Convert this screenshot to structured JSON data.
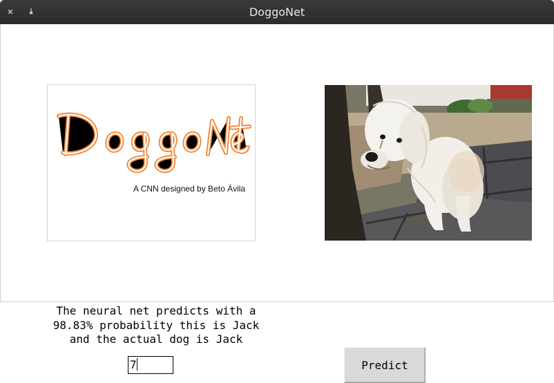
{
  "window": {
    "title": "DoggoNet",
    "close_glyph": "✕",
    "minimize_glyph": "⤓"
  },
  "logo": {
    "wordmark": "DoggoNet",
    "caption": "A CNN designed by Beto Ávila",
    "wordmark_color": "#f0883e"
  },
  "photo": {
    "icon": "dog-photo"
  },
  "prediction": {
    "lines": [
      "The neural net predicts with a",
      "98.83% probability this is Jack",
      "and the actual dog is Jack"
    ]
  },
  "index_input": {
    "value": "7"
  },
  "predict_button": {
    "label": "Predict"
  }
}
